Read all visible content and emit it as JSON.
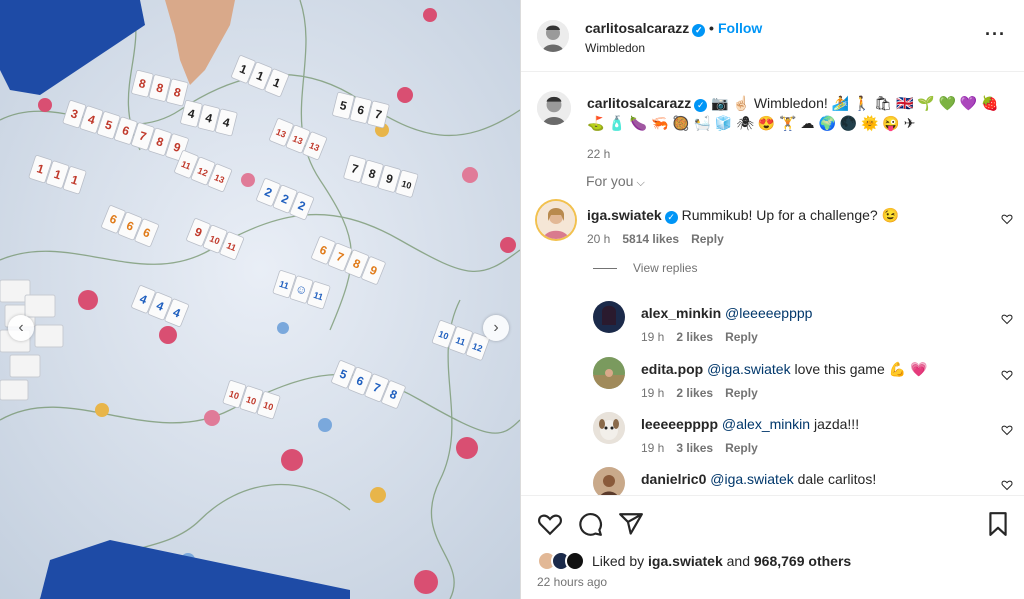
{
  "post": {
    "author": "carlitosalcarazz",
    "location": "Wimbledon",
    "follow_label": "Follow",
    "dot": "•",
    "more_label": "···",
    "caption_text": "📷 ☝🏻 Wimbledon! 🏄 🚶 🛍 🇬🇧 🌱 💚 💜 🍓 ⛳ 🧴 🍆 🦐 🥘 🛀 🧊 🕷 😍 🏋 ☁ 🌍 🌑 🌞 😜 ✈",
    "caption_time": "22 h",
    "for_you": "For you",
    "view_replies": "View replies",
    "liked_by_prefix": "Liked by",
    "liked_by_user": "iga.swiatek",
    "liked_by_and": "and",
    "liked_by_count": "968,769 others",
    "post_time": "22 hours ago"
  },
  "comments": [
    {
      "user": "iga.swiatek",
      "verified": true,
      "mention": "",
      "text": "Rummikub! Up for a challenge? 😉",
      "time": "20 h",
      "likes": "5814 likes",
      "reply": "Reply"
    }
  ],
  "replies": [
    {
      "user": "alex_minkin",
      "mention": "@leeeeepppp",
      "text": "",
      "time": "19 h",
      "likes": "2 likes",
      "reply": "Reply"
    },
    {
      "user": "edita.pop",
      "mention": "@iga.swiatek",
      "text": "love this game 💪 💗",
      "time": "19 h",
      "likes": "2 likes",
      "reply": "Reply"
    },
    {
      "user": "leeeeepppp",
      "mention": "@alex_minkin",
      "text": "jazda!!!",
      "time": "19 h",
      "likes": "3 likes",
      "reply": "Reply"
    },
    {
      "user": "danielric0",
      "mention": "@iga.swiatek",
      "text": "dale carlitos!",
      "time": "",
      "likes": "",
      "reply": ""
    }
  ],
  "photo_tiles": [
    {
      "n": "8 8 8",
      "c": "#c0392b"
    },
    {
      "n": "3 4 5 6 7 8 9",
      "c": "#c0392b"
    },
    {
      "n": "4 4 4",
      "c": "#222"
    },
    {
      "n": "1 1 1",
      "c": "#222"
    },
    {
      "n": "5 6 7",
      "c": "#222"
    },
    {
      "n": "13 13 13",
      "c": "#c0392b"
    },
    {
      "n": "1 1 1",
      "c": "#c0392b"
    },
    {
      "n": "11 12 13",
      "c": "#c0392b"
    },
    {
      "n": "7 8 9 10",
      "c": "#222"
    },
    {
      "n": "2 2 2",
      "c": "#1f5fbf"
    },
    {
      "n": "6 6 6",
      "c": "#e07b1a"
    },
    {
      "n": "9 10 11",
      "c": "#c0392b"
    },
    {
      "n": "6 7 8 9",
      "c": "#e07b1a"
    },
    {
      "n": "11 ☺ 11",
      "c": "#1f5fbf"
    },
    {
      "n": "4 4 4",
      "c": "#1f5fbf"
    },
    {
      "n": "10 11 12",
      "c": "#1f5fbf"
    },
    {
      "n": "5 6 7 8",
      "c": "#1f5fbf"
    },
    {
      "n": "10 10 10",
      "c": "#c0392b"
    }
  ],
  "colors": {
    "accent": "#0095f6",
    "muted": "#737373",
    "text": "#262626",
    "mention": "#00376b",
    "like_heart": "#ed4956"
  },
  "icons": [
    "more-icon",
    "verified-icon",
    "heart-icon",
    "comment-icon",
    "share-icon",
    "bookmark-icon",
    "chevron-down-icon",
    "chevron-left-icon",
    "chevron-right-icon"
  ]
}
